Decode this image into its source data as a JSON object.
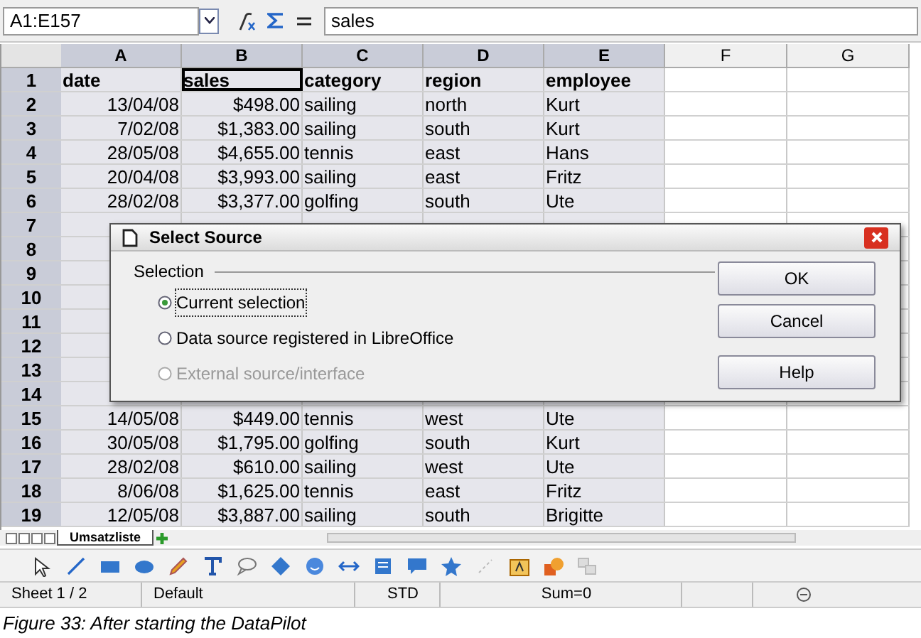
{
  "formula_bar": {
    "name_box": "A1:E157",
    "content": "sales"
  },
  "sheet": {
    "columns": [
      {
        "label": "A",
        "selected": true
      },
      {
        "label": "B",
        "selected": true
      },
      {
        "label": "C",
        "selected": true
      },
      {
        "label": "D",
        "selected": true
      },
      {
        "label": "E",
        "selected": true
      },
      {
        "label": "F",
        "selected": false
      },
      {
        "label": "G",
        "selected": false
      }
    ],
    "rows": [
      {
        "number": "1",
        "cells": [
          "date",
          "sales",
          "category",
          "region",
          "employee"
        ]
      },
      {
        "number": "2",
        "cells": [
          "13/04/08",
          "$498.00",
          "sailing",
          "north",
          "Kurt"
        ]
      },
      {
        "number": "3",
        "cells": [
          "7/02/08",
          "$1,383.00",
          "sailing",
          "south",
          "Kurt"
        ]
      },
      {
        "number": "4",
        "cells": [
          "28/05/08",
          "$4,655.00",
          "tennis",
          "east",
          "Hans"
        ]
      },
      {
        "number": "5",
        "cells": [
          "20/04/08",
          "$3,993.00",
          "sailing",
          "east",
          "Fritz"
        ]
      },
      {
        "number": "6",
        "cells": [
          "28/02/08",
          "$3,377.00",
          "golfing",
          "south",
          "Ute"
        ]
      },
      {
        "number": "7",
        "cells": []
      },
      {
        "number": "8",
        "cells": []
      },
      {
        "number": "9",
        "cells": []
      },
      {
        "number": "10",
        "cells": []
      },
      {
        "number": "11",
        "cells": []
      },
      {
        "number": "12",
        "cells": []
      },
      {
        "number": "13",
        "cells": []
      },
      {
        "number": "14",
        "cells": []
      },
      {
        "number": "15",
        "cells": [
          "14/05/08",
          "$449.00",
          "tennis",
          "west",
          "Ute"
        ]
      },
      {
        "number": "16",
        "cells": [
          "30/05/08",
          "$1,795.00",
          "golfing",
          "south",
          "Kurt"
        ]
      },
      {
        "number": "17",
        "cells": [
          "28/02/08",
          "$610.00",
          "sailing",
          "west",
          "Ute"
        ]
      },
      {
        "number": "18",
        "cells": [
          "8/06/08",
          "$1,625.00",
          "tennis",
          "east",
          "Fritz"
        ]
      },
      {
        "number": "19",
        "cells": [
          "12/05/08",
          "$3,887.00",
          "sailing",
          "south",
          "Brigitte"
        ]
      }
    ]
  },
  "sheet_tabs": [
    {
      "label": "Umsatzliste",
      "selected": true
    }
  ],
  "status_bar": [
    "Sheet 1 / 2",
    "Default",
    "STD",
    "Sum=0"
  ],
  "dialog": {
    "title": "Select Source",
    "group": "Selection",
    "options": [
      {
        "label": "Current selection",
        "selected": true,
        "disabled": false
      },
      {
        "label": "Data source registered in LibreOffice",
        "selected": false,
        "disabled": false
      },
      {
        "label": "External source/interface",
        "selected": false,
        "disabled": true
      }
    ],
    "buttons": [
      "OK",
      "Cancel",
      "Help"
    ]
  },
  "caption": "Figure 33: After starting the DataPilot"
}
